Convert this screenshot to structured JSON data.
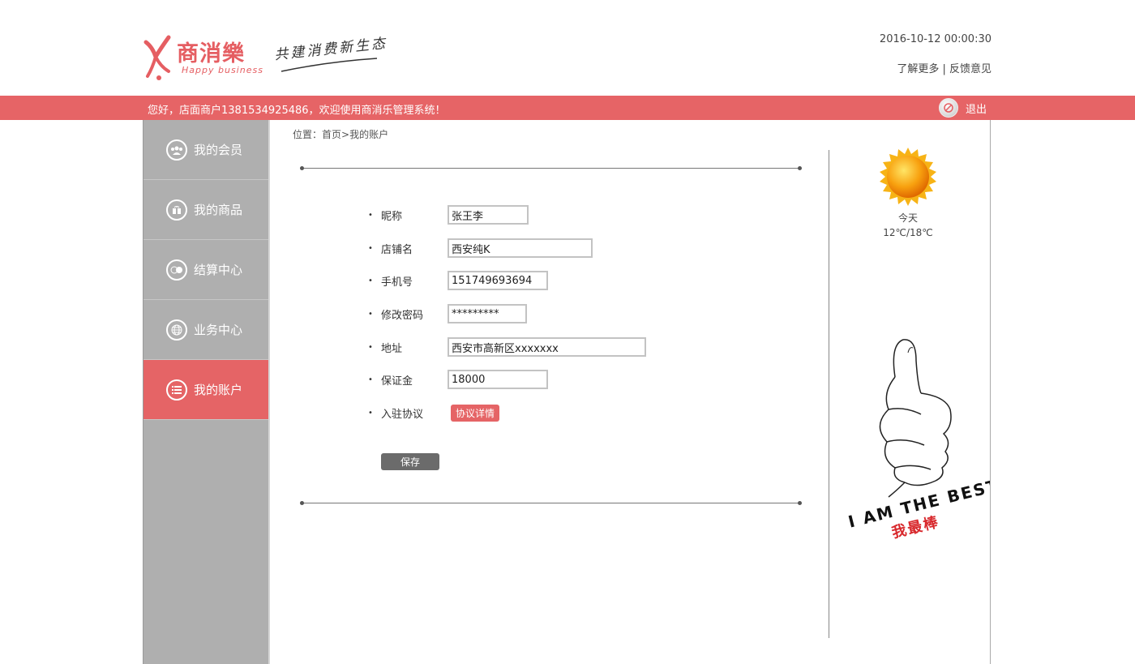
{
  "header": {
    "logo_text": "商消樂",
    "logo_sub": "Happy business",
    "slogan": "共建消费新生态",
    "datetime": "2016-10-12 00:00:30",
    "links": [
      "了解更多 | ",
      "反馈意见"
    ]
  },
  "topbar": {
    "welcome": "您好，店面商户1381534925486，欢迎使用商消乐管理系统！",
    "logout": "退出"
  },
  "sidebar": {
    "items": [
      {
        "label": "我的会员",
        "icon": "members-icon"
      },
      {
        "label": "我的商品",
        "icon": "gift-icon"
      },
      {
        "label": "结算中心",
        "icon": "money-icon"
      },
      {
        "label": "业务中心",
        "icon": "globe-icon"
      },
      {
        "label": "我的账户",
        "icon": "list-icon",
        "active": true
      }
    ]
  },
  "breadcrumb": {
    "prefix": "位置：",
    "home": "首页",
    "sep": ">",
    "current": "我的账户"
  },
  "form": {
    "nickname": {
      "label": "昵称",
      "value": "张王李"
    },
    "shop_name": {
      "label": "店铺名",
      "value": "西安纯K"
    },
    "phone": {
      "label": "手机号",
      "value": "151749693694"
    },
    "password": {
      "label": "修改密码",
      "value": "*********"
    },
    "address": {
      "label": "地址",
      "value": "西安市高新区xxxxxxx"
    },
    "deposit": {
      "label": "保证金",
      "value": "18000"
    },
    "agreement": {
      "label": "入驻协议",
      "button": "协议详情"
    },
    "save": "保存"
  },
  "weather": {
    "day": "今天",
    "temp": "12℃/18℃"
  },
  "promo": {
    "line1": "I AM THE BEST",
    "line2": "我最棒"
  },
  "colors": {
    "accent": "#e66466",
    "sidebar": "#afafaf"
  }
}
